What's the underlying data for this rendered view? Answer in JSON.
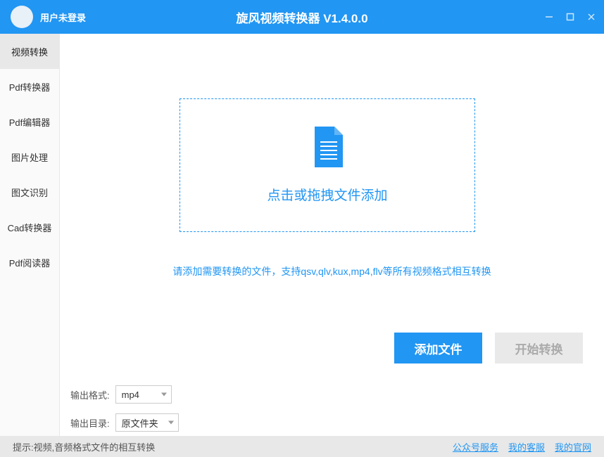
{
  "header": {
    "user_status": "用户未登录",
    "app_title": "旋风视频转换器 V1.4.0.0"
  },
  "sidebar": {
    "items": [
      {
        "label": "视频转换",
        "active": true
      },
      {
        "label": "Pdf转换器",
        "active": false
      },
      {
        "label": "Pdf编辑器",
        "active": false
      },
      {
        "label": "图片处理",
        "active": false
      },
      {
        "label": "图文识别",
        "active": false
      },
      {
        "label": "Cad转换器",
        "active": false
      },
      {
        "label": "Pdf阅读器",
        "active": false
      }
    ]
  },
  "dropzone": {
    "text": "点击或拖拽文件添加"
  },
  "hint": "请添加需要转换的文件，支持qsv,qlv,kux,mp4,flv等所有视频格式相互转换",
  "buttons": {
    "add_file": "添加文件",
    "start_convert": "开始转换"
  },
  "output": {
    "format_label": "输出格式:",
    "format_value": "mp4",
    "dir_label": "输出目录:",
    "dir_value": "原文件夹"
  },
  "footer": {
    "tip": "提示:视频,音频格式文件的相互转换",
    "links": {
      "wechat": "公众号服务",
      "support": "我的客服",
      "website": "我的官网"
    }
  }
}
